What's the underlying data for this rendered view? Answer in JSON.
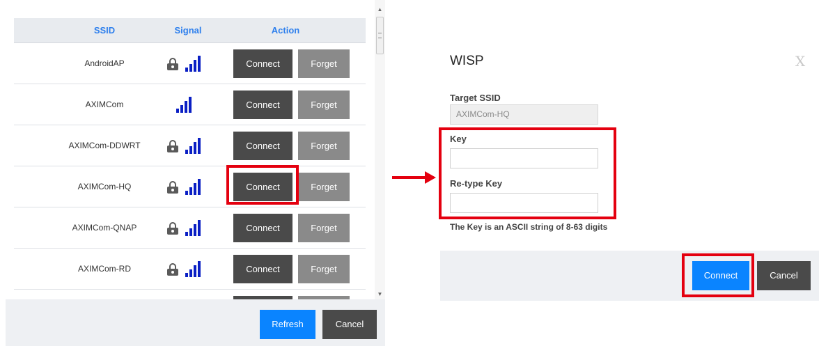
{
  "network_list": {
    "headers": {
      "ssid": "SSID",
      "signal": "Signal",
      "action": "Action"
    },
    "rows": [
      {
        "ssid": "AndroidAP",
        "secured": true,
        "connect": "Connect",
        "forget": "Forget"
      },
      {
        "ssid": "AXIMCom",
        "secured": false,
        "connect": "Connect",
        "forget": "Forget"
      },
      {
        "ssid": "AXIMCom-DDWRT",
        "secured": true,
        "connect": "Connect",
        "forget": "Forget"
      },
      {
        "ssid": "AXIMCom-HQ",
        "secured": true,
        "connect": "Connect",
        "forget": "Forget"
      },
      {
        "ssid": "AXIMCom-QNAP",
        "secured": true,
        "connect": "Connect",
        "forget": "Forget"
      },
      {
        "ssid": "AXIMCom-RD",
        "secured": true,
        "connect": "Connect",
        "forget": "Forget"
      }
    ],
    "footer": {
      "refresh_label": "Refresh",
      "cancel_label": "Cancel"
    }
  },
  "dialog": {
    "title": "WISP",
    "close_glyph": "X",
    "target_ssid_label": "Target SSID",
    "target_ssid_value": "AXIMCom-HQ",
    "key_label": "Key",
    "key_value": "",
    "retype_key_label": "Re-type Key",
    "retype_key_value": "",
    "hint": "The Key is an ASCII string of 8-63 digits",
    "connect_label": "Connect",
    "cancel_label": "Cancel"
  },
  "colors": {
    "accent_blue": "#0a84ff",
    "header_text": "#2f80ed",
    "signal_bars": "#0a1fc4",
    "highlight_red": "#e4000f",
    "button_dark": "#4a4a4a",
    "button_gray": "#8a8a8a"
  },
  "icons": {
    "lock": "lock-icon",
    "signal": "signal-bars-icon",
    "arrow": "arrow-right-icon"
  }
}
